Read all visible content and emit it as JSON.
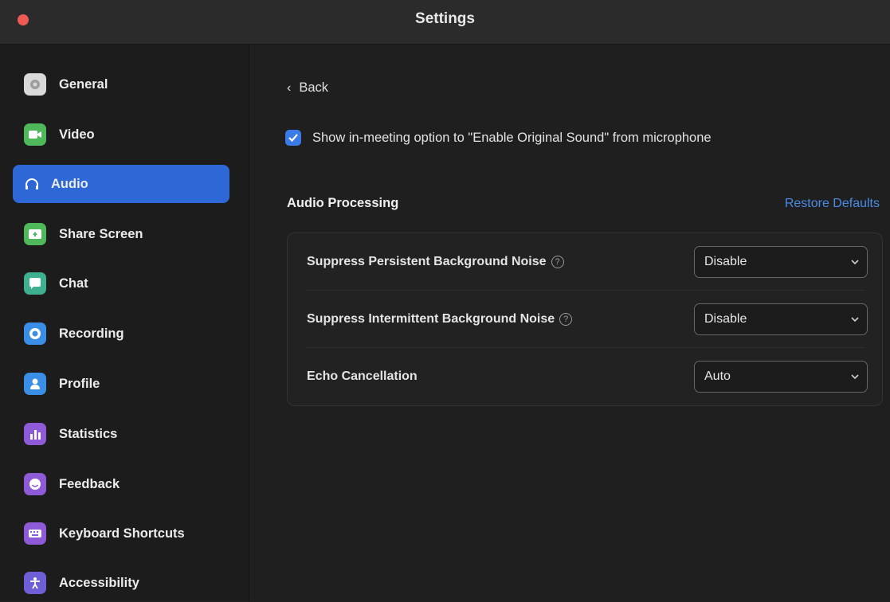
{
  "window": {
    "title": "Settings"
  },
  "sidebar": {
    "items": [
      {
        "label": "General",
        "icon": "gear-icon",
        "color": "#d9d9d9"
      },
      {
        "label": "Video",
        "icon": "video-camera-icon",
        "color": "#4fb85a"
      },
      {
        "label": "Audio",
        "icon": "headphones-icon",
        "color": "#2d68d6",
        "active": true
      },
      {
        "label": "Share Screen",
        "icon": "share-screen-icon",
        "color": "#4fb85a"
      },
      {
        "label": "Chat",
        "icon": "chat-bubble-icon",
        "color": "#3fb08f"
      },
      {
        "label": "Recording",
        "icon": "record-icon",
        "color": "#3a8ee6"
      },
      {
        "label": "Profile",
        "icon": "person-icon",
        "color": "#3a8ee6"
      },
      {
        "label": "Statistics",
        "icon": "bar-chart-icon",
        "color": "#8f5ad8"
      },
      {
        "label": "Feedback",
        "icon": "smiley-icon",
        "color": "#8f5ad8"
      },
      {
        "label": "Keyboard Shortcuts",
        "icon": "keyboard-icon",
        "color": "#8f5ad8"
      },
      {
        "label": "Accessibility",
        "icon": "accessibility-icon",
        "color": "#6f5fd6"
      }
    ]
  },
  "main": {
    "back_label": "Back",
    "original_sound_label": "Show in-meeting option to \"Enable Original Sound\" from microphone",
    "original_sound_checked": true,
    "section_title": "Audio Processing",
    "restore_label": "Restore Defaults",
    "rows": [
      {
        "label": "Suppress Persistent Background Noise",
        "value": "Disable",
        "has_help": true
      },
      {
        "label": "Suppress Intermittent Background Noise",
        "value": "Disable",
        "has_help": true
      },
      {
        "label": "Echo Cancellation",
        "value": "Auto",
        "has_help": false
      }
    ],
    "help_glyph": "?"
  }
}
